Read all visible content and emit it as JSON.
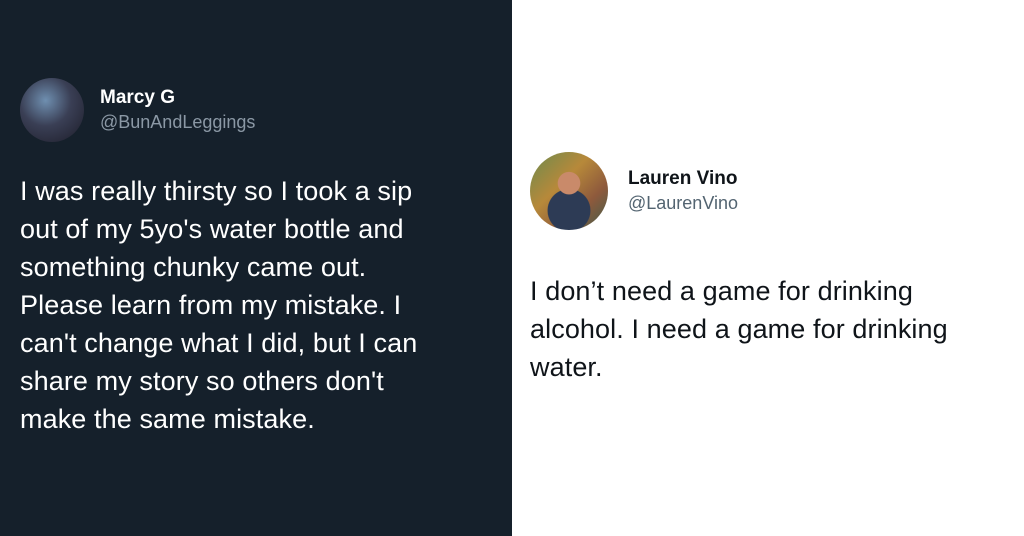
{
  "left_tweet": {
    "name": "Marcy G",
    "handle": "@BunAndLeggings",
    "lines": [
      "I was really thirsty so I took a sip",
      "out of my 5yo's water bottle and",
      "something chunky came out.",
      "Please learn from my mistake. I",
      "can't change what I did, but I can",
      "share my story so others don't",
      "make the same mistake."
    ]
  },
  "right_tweet": {
    "name": "Lauren Vino",
    "handle": "@LaurenVino",
    "lines": [
      "I don’t need a game for drinking",
      "alcohol. I need a game for drinking",
      "water."
    ]
  }
}
